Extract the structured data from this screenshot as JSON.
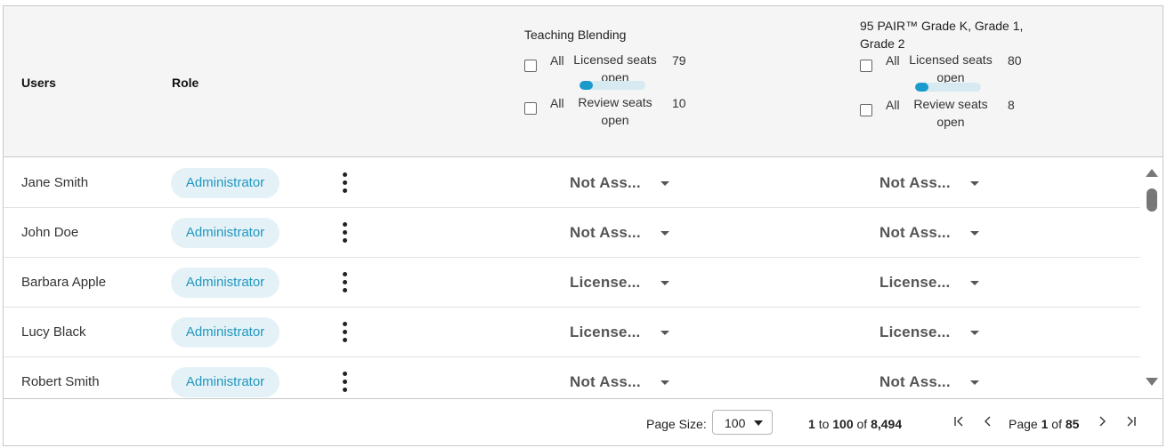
{
  "header": {
    "users_label": "Users",
    "role_label": "Role",
    "products": [
      {
        "title_lines": [
          "Teaching Blending",
          ""
        ],
        "licensed": {
          "all_label": "All",
          "label_line1": "Licensed seats",
          "label_line2": "open",
          "count": "79"
        },
        "licensed_fill_fraction": 0.2,
        "review": {
          "all_label": "All",
          "label_line1": "Review seats",
          "label_line2": "open",
          "count": "10"
        }
      },
      {
        "title_lines": [
          "95 PAIR™ Grade K, Grade 1,",
          "Grade 2"
        ],
        "licensed": {
          "all_label": "All",
          "label_line1": "Licensed seats",
          "label_line2": "open",
          "count": "80"
        },
        "licensed_fill_fraction": 0.2,
        "review": {
          "all_label": "All",
          "label_line1": "Review seats",
          "label_line2": "open",
          "count": "8"
        }
      }
    ]
  },
  "rows": [
    {
      "user": "Jane Smith",
      "role": "Administrator",
      "product1": "Not Ass...",
      "product2": "Not Ass..."
    },
    {
      "user": "John Doe",
      "role": "Administrator",
      "product1": "Not Ass...",
      "product2": "Not Ass..."
    },
    {
      "user": "Barbara Apple",
      "role": "Administrator",
      "product1": "License...",
      "product2": "License..."
    },
    {
      "user": "Lucy Black",
      "role": "Administrator",
      "product1": "License...",
      "product2": "License..."
    },
    {
      "user": "Robert Smith",
      "role": "Administrator",
      "product1": "Not Ass...",
      "product2": "Not Ass..."
    }
  ],
  "footer": {
    "page_size_label": "Page Size:",
    "page_size_value": "100",
    "range_from": "1",
    "range_to_word": "to",
    "range_to": "100",
    "range_of_word": "of",
    "range_total": "8,494",
    "page_word": "Page",
    "page_current": "1",
    "page_of_word": "of",
    "page_total": "85"
  },
  "icons": {
    "first_page": "first-page-icon",
    "prev_page": "prev-page-icon",
    "next_page": "next-page-icon",
    "last_page": "last-page-icon",
    "more": "kebab-menu-icon",
    "dropdown": "chevron-down-icon"
  },
  "colors": {
    "accent": "#1a9bcc",
    "badge_bg": "#e4f2f7",
    "badge_text": "#1f96bf",
    "header_bg": "#f5f5f5"
  }
}
